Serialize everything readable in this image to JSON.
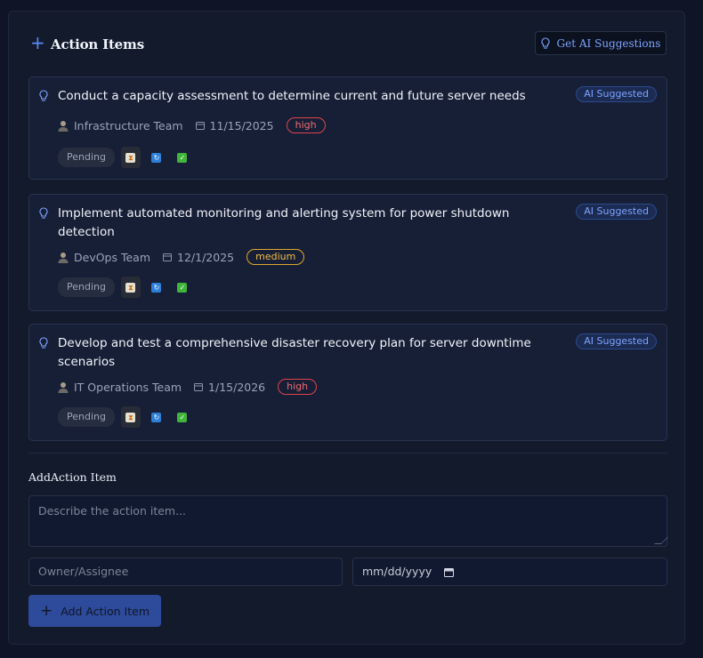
{
  "header": {
    "title": "Action Items",
    "ai_button_label": "Get AI Suggestions"
  },
  "items": [
    {
      "text": "Conduct a capacity assessment to determine current and future server needs",
      "tag": "AI Suggested",
      "owner": "Infrastructure Team",
      "date": "11/15/2025",
      "priority": "high",
      "status": "Pending"
    },
    {
      "text": "Implement automated monitoring and alerting system for power shutdown detection",
      "tag": "AI Suggested",
      "owner": "DevOps Team",
      "date": "12/1/2025",
      "priority": "medium",
      "status": "Pending"
    },
    {
      "text": "Develop and test a comprehensive disaster recovery plan for server downtime scenarios",
      "tag": "AI Suggested",
      "owner": "IT Operations Team",
      "date": "1/15/2026",
      "priority": "high",
      "status": "Pending"
    }
  ],
  "form": {
    "title": "AddAction Item",
    "description_placeholder": "Describe the action item...",
    "owner_placeholder": "Owner/Assignee",
    "date_placeholder": "mm/dd/yyyy",
    "add_button_label": "Add Action Item"
  },
  "icons": {
    "header": "plus-icon",
    "ai_button": "lightbulb-icon",
    "card": "lightbulb-icon",
    "owner": "person-icon",
    "date": "calendar-icon",
    "actions": [
      "hourglass-icon",
      "refresh-icon",
      "checkmark-icon"
    ]
  },
  "colors": {
    "accent": "#5b8af5",
    "high": "#e0434d",
    "medium": "#e0a82e"
  }
}
